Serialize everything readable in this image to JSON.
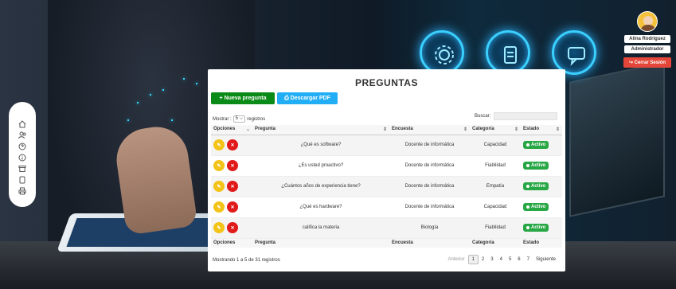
{
  "user": {
    "name": "Alina Rodriguez",
    "role": "Administrador",
    "logout_label": "↪ Cerrar Sesión"
  },
  "sidebar": {
    "items": [
      {
        "icon": "home-icon",
        "glyph": "⌂"
      },
      {
        "icon": "users-icon",
        "glyph": "☺"
      },
      {
        "icon": "question-icon",
        "glyph": "?"
      },
      {
        "icon": "info-icon",
        "glyph": "i"
      },
      {
        "icon": "archive-icon",
        "glyph": "▤"
      },
      {
        "icon": "document-icon",
        "glyph": "▯"
      },
      {
        "icon": "printer-icon",
        "glyph": "⎙"
      }
    ]
  },
  "page": {
    "title": "PREGUNTAS",
    "new_button": "+ Nueva pregunta",
    "pdf_button": "⎙ Descargar PDF",
    "show_label": "Mostrar :",
    "show_value": "5 ⌵",
    "show_suffix": "registros",
    "search_label": "Buscar:",
    "search_value": ""
  },
  "table": {
    "headers": {
      "opciones": "Opciones",
      "pregunta": "Pregunta",
      "encuesta": "Encuesta",
      "categoria": "Categoría",
      "estado": "Estado"
    },
    "rows": [
      {
        "pregunta": "¿Qué es software?",
        "encuesta": "Docente de informática",
        "categoria": "Capacidad",
        "estado": "Activo"
      },
      {
        "pregunta": "¿Es usted proactivo?",
        "encuesta": "Docente de informática",
        "categoria": "Fiabilidad",
        "estado": "Activo"
      },
      {
        "pregunta": "¿Cuántos años de experiencia tiene?",
        "encuesta": "Docente de informática",
        "categoria": "Empatía",
        "estado": "Activo"
      },
      {
        "pregunta": "¿Qué es hardware?",
        "encuesta": "Docente de informática",
        "categoria": "Capacidad",
        "estado": "Activo"
      },
      {
        "pregunta": "califica la materia",
        "encuesta": "Biología",
        "categoria": "Fiabilidad",
        "estado": "Activo"
      }
    ]
  },
  "footer": {
    "info": "Mostrando 1 a 5 de 31 registros",
    "prev": "Anterior",
    "pages": [
      "1",
      "2",
      "3",
      "4",
      "5",
      "6",
      "7"
    ],
    "current_page": "1",
    "next": "Siguiente"
  },
  "colors": {
    "new_button": "#0a8a16",
    "pdf_button": "#22aef5",
    "edit": "#f3c318",
    "delete": "#e11a1a",
    "active": "#28a745",
    "logout": "#e4473a"
  }
}
